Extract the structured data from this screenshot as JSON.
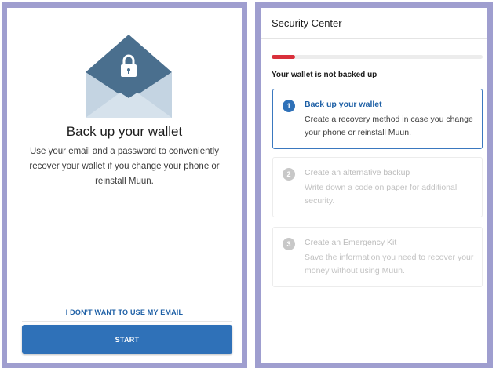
{
  "left": {
    "title": "Back up your wallet",
    "description": "Use your email and a password to conveniently recover your wallet if you change your phone or reinstall Muun.",
    "skip_link": "I DON'T WANT TO USE MY EMAIL",
    "start_button": "START",
    "icons": {
      "envelope": "envelope-lock-icon"
    }
  },
  "right": {
    "header": "Security Center",
    "progress": 0.11,
    "status": "Your wallet is not backed up",
    "steps": [
      {
        "number": "1",
        "title": "Back up your wallet",
        "description": "Create a recovery method in case you change your phone or reinstall Muun.",
        "active": true
      },
      {
        "number": "2",
        "title": "Create an alternative backup",
        "description": "Write down a code on paper for additional security.",
        "active": false
      },
      {
        "number": "3",
        "title": "Create an Emergency Kit",
        "description": "Save the information you need to recover your money without using Muun.",
        "active": false
      }
    ]
  },
  "colors": {
    "frame": "#9f9ecf",
    "primary": "#2f71b8",
    "link": "#1d5fa5",
    "progress": "#d9303b",
    "envelope_dark": "#4a6f8e",
    "envelope_light": "#c4d4e2"
  }
}
